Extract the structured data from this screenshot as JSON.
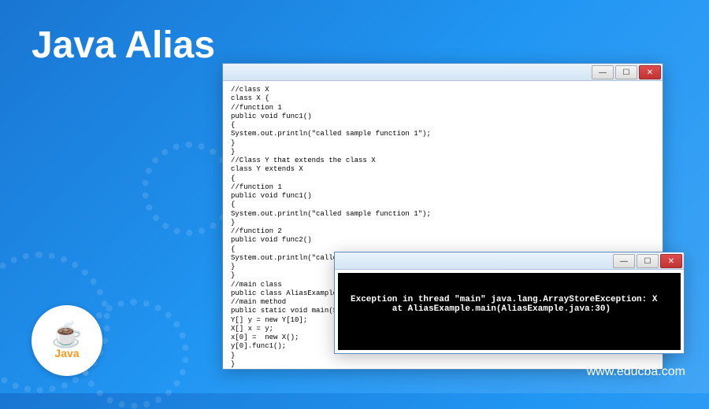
{
  "title": "Java Alias",
  "logo": {
    "symbol": "☕",
    "text": "Java"
  },
  "url": "www.educba.com",
  "codeWindow": {
    "buttons": {
      "min": "—",
      "max": "☐",
      "close": "✕"
    },
    "code": "//class X\nclass X {\n//function 1\npublic void func1()\n{\nSystem.out.println(\"called sample function 1\");\n}\n}\n//Class Y that extends the class X\nclass Y extends X\n{\n//function 1\npublic void func1()\n{\nSystem.out.println(\"called sample function 1\");\n}\n//function 2\npublic void func2()\n{\nSystem.out.println(\"called sample function 2\");\n}\n}\n//main class\npublic class AliasExample {\n//main method\npublic static void main(String\nY[] y = new Y[10];\nX[] x = y;\nx[0] =  new X();\ny[0].func1();\n}\n}"
  },
  "consoleWindow": {
    "buttons": {
      "min": "—",
      "max": "☐",
      "close": "✕"
    },
    "output": "Exception in thread \"main\" java.lang.ArrayStoreException: X\n        at AliasExample.main(AliasExample.java:30)"
  }
}
